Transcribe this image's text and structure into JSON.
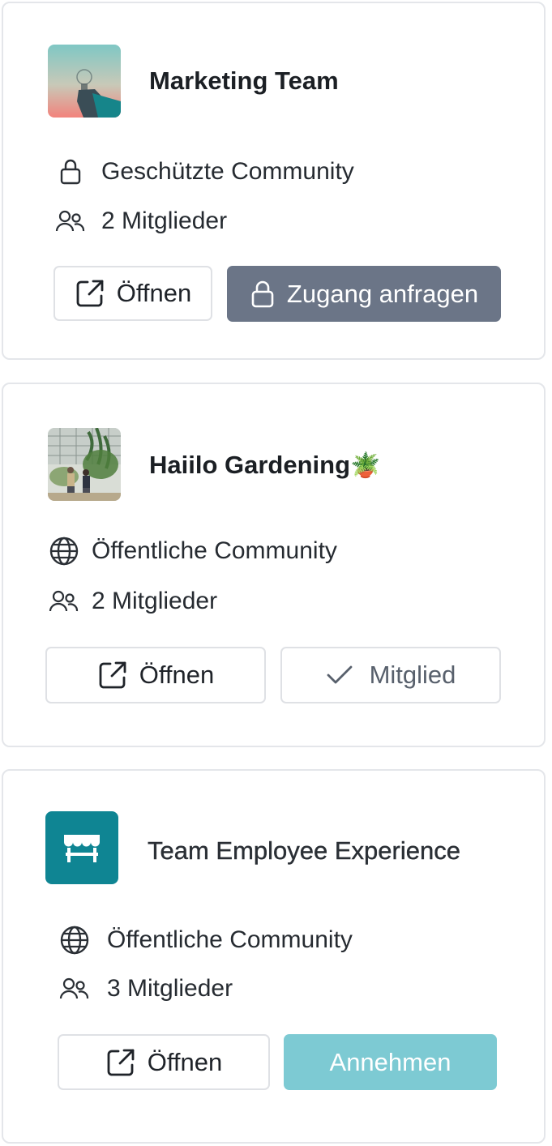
{
  "colors": {
    "border": "#e4e6ea",
    "grey_button": "#6b7587",
    "teal_button": "#7dcad3",
    "teal_avatar": "#0f8593"
  },
  "communities": [
    {
      "name": "Marketing Team",
      "avatar": "lightbulb-photo",
      "visibility_icon": "lock-icon",
      "visibility": "Geschützte Community",
      "members": "2 Mitglieder",
      "open_label": "Öffnen",
      "action_label": "Zugang anfragen",
      "action_icon": "lock-icon"
    },
    {
      "name": "Haiilo Gardening",
      "name_emoji": "🪴",
      "avatar": "people-in-greenhouse-photo",
      "visibility_icon": "globe-icon",
      "visibility": "Öffentliche Community",
      "members": "2 Mitglieder",
      "open_label": "Öffnen",
      "action_label": "Mitglied",
      "action_icon": "check-icon"
    },
    {
      "name": "Team Employee Experience",
      "avatar": "storefront-icon",
      "visibility_icon": "globe-icon",
      "visibility": "Öffentliche Community",
      "members": "3 Mitglieder",
      "open_label": "Öffnen",
      "action_label": "Annehmen"
    }
  ]
}
